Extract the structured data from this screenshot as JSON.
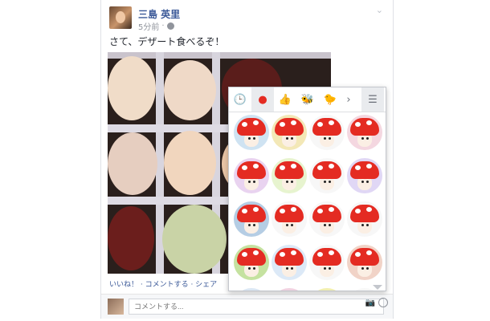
{
  "post": {
    "author": "三島 英里",
    "time": "5分前",
    "status": "さて、デザート食べるぞ！",
    "actions": "いいね！ · コメントする · シェア"
  },
  "comment": {
    "placeholder": "コメントする..."
  },
  "picker": {
    "tabs": [
      "recent-clock-icon",
      "mushroom-sticker-tab",
      "thumbs-up-sticker-tab",
      "bee-sticker-tab",
      "bird-sticker-tab",
      "next-arrow-icon",
      "sticker-store-icon"
    ]
  },
  "colors": {
    "link": "#3b5998",
    "mushroom_red": "#e42b22"
  }
}
